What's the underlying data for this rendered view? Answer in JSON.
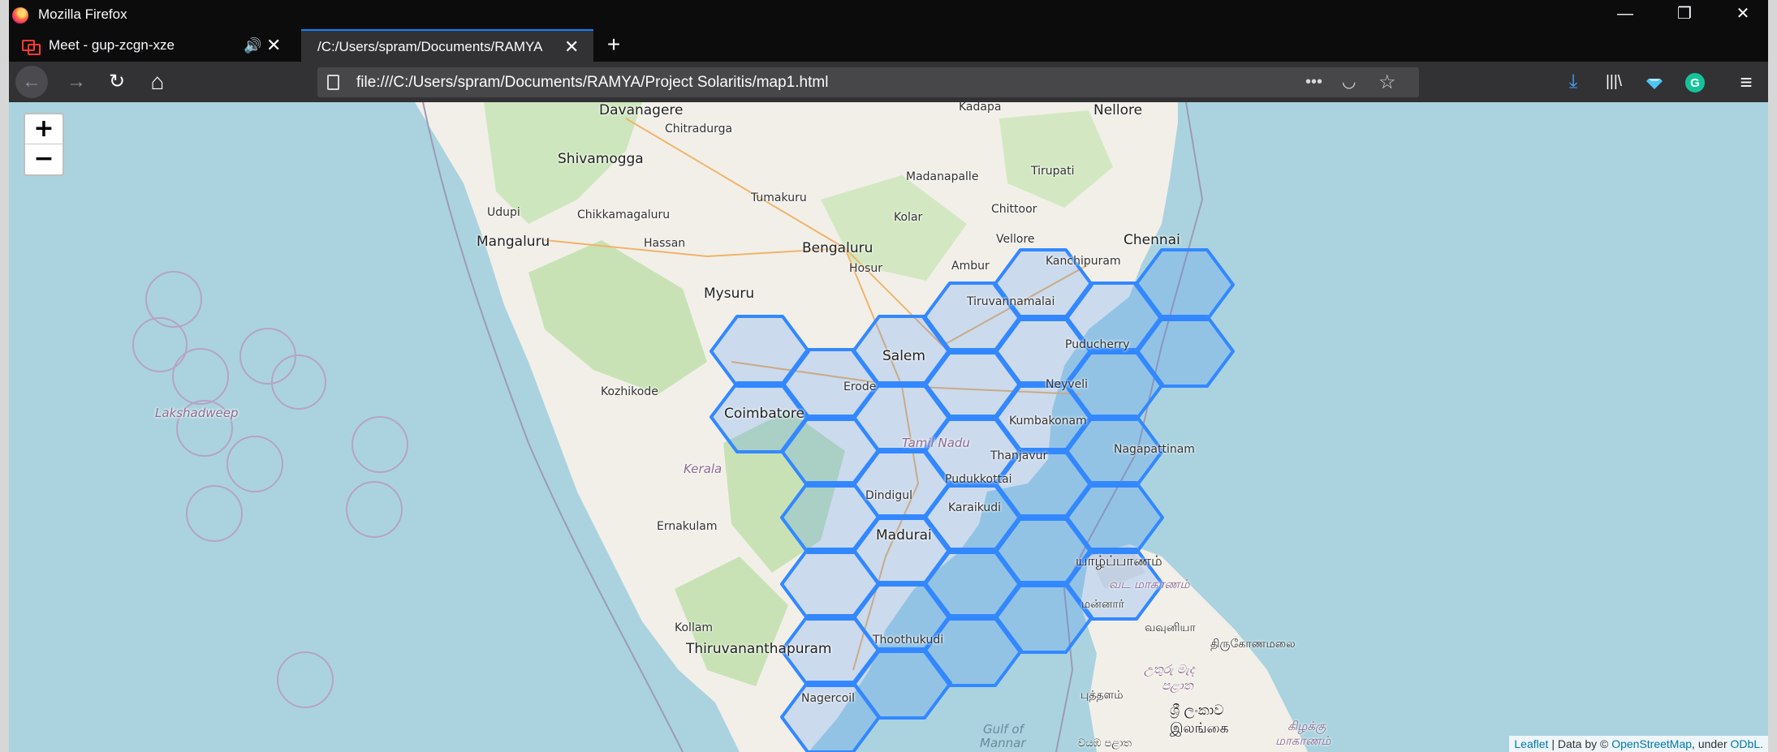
{
  "window": {
    "title": "Mozilla Firefox",
    "controls": [
      "—",
      "❐",
      "✕"
    ]
  },
  "tabs": [
    {
      "label": "Meet - gup-zcgn-xze",
      "audio_icon": "🔊",
      "close": "✕"
    },
    {
      "label": "/C:/Users/spram/Documents/RAMYA",
      "close": "✕"
    }
  ],
  "new_tab": "+",
  "nav": {
    "back": "←",
    "forward": "→",
    "reload": "↻",
    "home": "⌂",
    "url": "file:///C:/Users/spram/Documents/RAMYA/Project Solaritis/map1.html",
    "page_actions": "•••",
    "pocket": "◡",
    "bookmark": "☆",
    "download": "⤓",
    "library": "|||\\",
    "menu": "≡"
  },
  "map": {
    "zoom_in": "+",
    "zoom_out": "−",
    "attribution": {
      "leaflet": "Leaflet",
      "sep": " | Data by © ",
      "osm": "OpenStreetMap",
      "under": ", under ",
      "odbl": "ODbL."
    },
    "labels": {
      "davanagere": "Davanagere",
      "chitradurga": "Chitradurga",
      "kadapa": "Kadapa",
      "nellore": "Nellore",
      "shivamogga": "Shivamogga",
      "madanapalle": "Madanapalle",
      "tirupati": "Tirupati",
      "udupi": "Udupi",
      "chikkamagaluru": "Chikkamagaluru",
      "tumakuru": "Tumakuru",
      "kolar": "Kolar",
      "chittoor": "Chittoor",
      "mangaluru": "Mangaluru",
      "hassan": "Hassan",
      "bengaluru": "Bengaluru",
      "vellore": "Vellore",
      "chennai": "Chennai",
      "hosur": "Hosur",
      "ambur": "Ambur",
      "kanchipuram": "Kanchipuram",
      "mysuru": "Mysuru",
      "tiruvannamalai": "Tiruvannamalai",
      "salem": "Salem",
      "puducherry": "Puducherry",
      "kozhikode": "Kozhikode",
      "erode": "Erode",
      "neyveli": "Neyveli",
      "lakshadweep": "Lakshadweep",
      "coimbatore": "Coimbatore",
      "kumbakonam": "Kumbakonam",
      "tamil_nadu": "Tamil Nadu",
      "nagapattinam": "Nagapattinam",
      "kerala": "Kerala",
      "thanjavur": "Thanjavur",
      "pudukkottai": "Pudukkottai",
      "dindigul": "Dindigul",
      "karaikudi": "Karaikudi",
      "ernakulam": "Ernakulam",
      "madurai": "Madurai",
      "jaffna": "யாழ்ப்பாணம்",
      "north_province": "வட மாகாணம்",
      "mannar": "மன்னார்",
      "vavuniya": "வவுனியா",
      "kollam": "Kollam",
      "thoothukudi": "Thoothukudi",
      "thiruvananthapuram": "Thiruvananthapuram",
      "trincomalee": "திருகோணமலை",
      "uturu_palata": "උතුරු මැද",
      "palata": "පළාත",
      "puttalam": "புத்தளம்",
      "sri_lanka_si": "ශ්‍රී ලංකාව",
      "sri_lanka_ta": "இலங்கை",
      "kilakku": "கிழக்கு",
      "maakaanam": "மாகாணம்",
      "nagercoil": "Nagercoil",
      "gulf_of": "Gulf of",
      "mannar_gulf": "Mannar",
      "vayamba": "වයඹ පළාත"
    },
    "colors": {
      "sea": "#aad3df",
      "land": "#f2efe9",
      "hex_stroke": "#3388ff",
      "hex_fill": "#3388ff"
    }
  }
}
